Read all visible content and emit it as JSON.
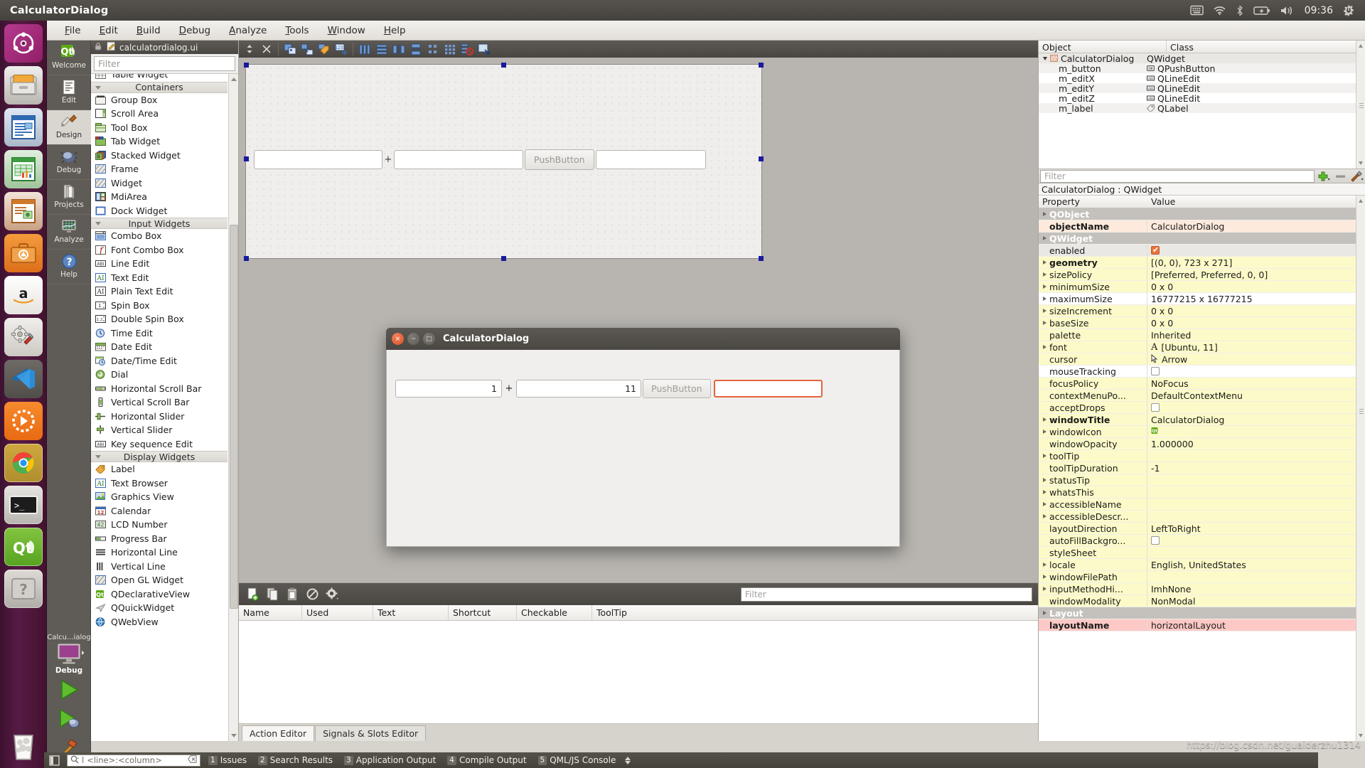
{
  "window": {
    "title": "CalculatorDialog"
  },
  "tray": {
    "icons": [
      "keyboard-icon",
      "wifi-icon",
      "bluetooth-icon",
      "battery-icon",
      "volume-icon"
    ],
    "clock": "09:36",
    "session_icon": "gear-power-icon"
  },
  "launcher": {
    "items": [
      {
        "name": "ubuntu-dash",
        "label": "Ubuntu Dash"
      },
      {
        "name": "files",
        "label": "Files"
      },
      {
        "name": "libreoffice-writer",
        "label": "LibreOffice Writer"
      },
      {
        "name": "libreoffice-calc",
        "label": "LibreOffice Calc"
      },
      {
        "name": "libreoffice-impress",
        "label": "LibreOffice Impress"
      },
      {
        "name": "ubuntu-software",
        "label": "Ubuntu Software"
      },
      {
        "name": "amazon",
        "label": "Amazon"
      },
      {
        "name": "system-settings",
        "label": "System Settings"
      },
      {
        "name": "vs-code",
        "label": "Visual Studio Code"
      },
      {
        "name": "vlc",
        "label": "VLC"
      },
      {
        "name": "google-chrome",
        "label": "Google Chrome"
      },
      {
        "name": "terminal",
        "label": "Terminal"
      },
      {
        "name": "qt-creator",
        "label": "Qt Creator"
      },
      {
        "name": "help",
        "label": "Help"
      }
    ],
    "trash_label": "Trash"
  },
  "menubar": {
    "items": [
      {
        "label": "File",
        "mnemonic": "F"
      },
      {
        "label": "Edit",
        "mnemonic": "E"
      },
      {
        "label": "Build",
        "mnemonic": "B"
      },
      {
        "label": "Debug",
        "mnemonic": "D"
      },
      {
        "label": "Analyze",
        "mnemonic": "A"
      },
      {
        "label": "Tools",
        "mnemonic": "T"
      },
      {
        "label": "Window",
        "mnemonic": "W"
      },
      {
        "label": "Help",
        "mnemonic": "H"
      }
    ]
  },
  "modes": [
    {
      "label": "Welcome",
      "icon": "qt-logo-icon",
      "active": false
    },
    {
      "label": "Edit",
      "icon": "document-icon",
      "active": false
    },
    {
      "label": "Design",
      "icon": "ruler-pencil-icon",
      "active": true
    },
    {
      "label": "Debug",
      "icon": "bug-icon",
      "active": false
    },
    {
      "label": "Projects",
      "icon": "book-icon",
      "active": false
    },
    {
      "label": "Analyze",
      "icon": "monitor-graph-icon",
      "active": false
    },
    {
      "label": "Help",
      "icon": "question-mark-icon",
      "active": false
    }
  ],
  "run_block": {
    "kit_label": "Calcu...ialog",
    "build_config": "Debug",
    "run_label": "Run",
    "debug_label": "Start Debugging",
    "build_label": "Build"
  },
  "widget_box": {
    "dock_title": "calculatordialog.ui",
    "filter_placeholder": "Filter",
    "clipped_top_item": "Table Widget",
    "categories": [
      {
        "name": "Containers",
        "items": [
          {
            "label": "Group Box",
            "icon": "group-box-icon"
          },
          {
            "label": "Scroll Area",
            "icon": "scroll-area-icon"
          },
          {
            "label": "Tool Box",
            "icon": "tool-box-icon"
          },
          {
            "label": "Tab Widget",
            "icon": "tab-widget-icon"
          },
          {
            "label": "Stacked Widget",
            "icon": "stacked-widget-icon"
          },
          {
            "label": "Frame",
            "icon": "frame-icon"
          },
          {
            "label": "Widget",
            "icon": "widget-icon"
          },
          {
            "label": "MdiArea",
            "icon": "mdi-area-icon"
          },
          {
            "label": "Dock Widget",
            "icon": "dock-widget-icon"
          }
        ]
      },
      {
        "name": "Input Widgets",
        "items": [
          {
            "label": "Combo Box",
            "icon": "combo-box-icon"
          },
          {
            "label": "Font Combo Box",
            "icon": "font-combo-box-icon"
          },
          {
            "label": "Line Edit",
            "icon": "line-edit-icon"
          },
          {
            "label": "Text Edit",
            "icon": "text-edit-icon"
          },
          {
            "label": "Plain Text Edit",
            "icon": "plain-text-edit-icon"
          },
          {
            "label": "Spin Box",
            "icon": "spin-box-icon"
          },
          {
            "label": "Double Spin Box",
            "icon": "double-spin-box-icon"
          },
          {
            "label": "Time Edit",
            "icon": "time-edit-icon"
          },
          {
            "label": "Date Edit",
            "icon": "date-edit-icon"
          },
          {
            "label": "Date/Time Edit",
            "icon": "date-time-edit-icon"
          },
          {
            "label": "Dial",
            "icon": "dial-icon"
          },
          {
            "label": "Horizontal Scroll Bar",
            "icon": "horizontal-scroll-bar-icon"
          },
          {
            "label": "Vertical Scroll Bar",
            "icon": "vertical-scroll-bar-icon"
          },
          {
            "label": "Horizontal Slider",
            "icon": "horizontal-slider-icon"
          },
          {
            "label": "Vertical Slider",
            "icon": "vertical-slider-icon"
          },
          {
            "label": "Key sequence Edit",
            "icon": "key-sequence-edit-icon"
          }
        ]
      },
      {
        "name": "Display Widgets",
        "items": [
          {
            "label": "Label",
            "icon": "label-icon"
          },
          {
            "label": "Text Browser",
            "icon": "text-browser-icon"
          },
          {
            "label": "Graphics View",
            "icon": "graphics-view-icon"
          },
          {
            "label": "Calendar",
            "icon": "calendar-icon"
          },
          {
            "label": "LCD Number",
            "icon": "lcd-number-icon"
          },
          {
            "label": "Progress Bar",
            "icon": "progress-bar-icon"
          },
          {
            "label": "Horizontal Line",
            "icon": "horizontal-line-icon"
          },
          {
            "label": "Vertical Line",
            "icon": "vertical-line-icon"
          },
          {
            "label": "Open GL Widget",
            "icon": "open-gl-widget-icon"
          },
          {
            "label": "QDeclarativeView",
            "icon": "qdeclarativeview-icon"
          },
          {
            "label": "QQuickWidget",
            "icon": "qquickwidget-icon"
          },
          {
            "label": "QWebView",
            "icon": "qwebview-icon"
          }
        ]
      }
    ]
  },
  "editor": {
    "document_name": "calculatordialog.ui",
    "toolbar_icons": [
      "split-selector-icon",
      "close-icon",
      "edit-widgets-icon",
      "edit-signals-slots-icon",
      "edit-buddies-icon",
      "edit-tab-order-icon",
      "layout-horizontally-icon",
      "layout-vertically-icon",
      "layout-splitter-h-icon",
      "layout-splitter-v-icon",
      "layout-form-icon",
      "layout-grid-icon",
      "break-layout-icon",
      "adjust-size-icon"
    ]
  },
  "form_preview": {
    "edit_x": "",
    "operator": "+",
    "edit_y": "",
    "button_label": "PushButton",
    "edit_z": ""
  },
  "running_dialog": {
    "title": "CalculatorDialog",
    "edit_x": "1",
    "operator": "+",
    "edit_y": "11",
    "button_label": "PushButton",
    "edit_z": ""
  },
  "object_inspector": {
    "headers": [
      "Object",
      "Class"
    ],
    "rows": [
      {
        "object": "CalculatorDialog",
        "class": "QWidget",
        "icon": "qwidget-icon",
        "depth": 0,
        "expanded": true,
        "selected": true
      },
      {
        "object": "m_button",
        "class": "QPushButton",
        "icon": "qpushbutton-icon",
        "depth": 1,
        "selected": false
      },
      {
        "object": "m_editX",
        "class": "QLineEdit",
        "icon": "qlineedit-icon",
        "depth": 1,
        "selected": false
      },
      {
        "object": "m_editY",
        "class": "QLineEdit",
        "icon": "qlineedit-icon",
        "depth": 1,
        "selected": false
      },
      {
        "object": "m_editZ",
        "class": "QLineEdit",
        "icon": "qlineedit-icon",
        "depth": 1,
        "selected": false
      },
      {
        "object": "m_label",
        "class": "QLabel",
        "icon": "qlabel-icon",
        "depth": 1,
        "selected": false
      }
    ]
  },
  "property_editor": {
    "filter_placeholder": "Filter",
    "add_button": "add-icon",
    "remove_button": "remove-icon",
    "configure_button": "configure-icon",
    "selection": "CalculatorDialog : QWidget",
    "headers": [
      "Property",
      "Value"
    ],
    "rows": [
      {
        "name": "QObject",
        "value": "",
        "style": "group",
        "expander": true
      },
      {
        "name": "objectName",
        "value": "CalculatorDialog",
        "style": "peach",
        "bold": true
      },
      {
        "name": "QWidget",
        "value": "",
        "style": "group",
        "expander": true
      },
      {
        "name": "enabled",
        "value": "",
        "style": "gray",
        "checkbox": "on",
        "revert": true
      },
      {
        "name": "geometry",
        "value": "[(0, 0), 723 x 271]",
        "style": "yellow",
        "expander": true,
        "bold": true
      },
      {
        "name": "sizePolicy",
        "value": "[Preferred, Preferred, 0, 0]",
        "style": "yellow",
        "expander": true
      },
      {
        "name": "minimumSize",
        "value": "0 x 0",
        "style": "yellow",
        "expander": true
      },
      {
        "name": "maximumSize",
        "value": "16777215 x 16777215",
        "style": "white",
        "expander": true
      },
      {
        "name": "sizeIncrement",
        "value": "0 x 0",
        "style": "yellow",
        "expander": true
      },
      {
        "name": "baseSize",
        "value": "0 x 0",
        "style": "yellow",
        "expander": true
      },
      {
        "name": "palette",
        "value": "Inherited",
        "style": "yellow"
      },
      {
        "name": "font",
        "value": "[Ubuntu, 11]",
        "style": "yellow",
        "expander": true,
        "glyph": "A"
      },
      {
        "name": "cursor",
        "value": "Arrow",
        "style": "yellow",
        "glyph": "cursor-arrow-icon"
      },
      {
        "name": "mouseTracking",
        "value": "",
        "style": "white",
        "checkbox": "off"
      },
      {
        "name": "focusPolicy",
        "value": "NoFocus",
        "style": "yellow"
      },
      {
        "name": "contextMenuPo...",
        "value": "DefaultContextMenu",
        "style": "yellow"
      },
      {
        "name": "acceptDrops",
        "value": "",
        "style": "yellow",
        "checkbox": "off"
      },
      {
        "name": "windowTitle",
        "value": "CalculatorDialog",
        "style": "yellow",
        "expander": true,
        "bold": true
      },
      {
        "name": "windowIcon",
        "value": "",
        "style": "yellow",
        "expander": true,
        "glyph": "qt-icon"
      },
      {
        "name": "windowOpacity",
        "value": "1.000000",
        "style": "yellow"
      },
      {
        "name": "toolTip",
        "value": "",
        "style": "yellow",
        "expander": true
      },
      {
        "name": "toolTipDuration",
        "value": "-1",
        "style": "yellow"
      },
      {
        "name": "statusTip",
        "value": "",
        "style": "yellow",
        "expander": true
      },
      {
        "name": "whatsThis",
        "value": "",
        "style": "yellow",
        "expander": true
      },
      {
        "name": "accessibleName",
        "value": "",
        "style": "yellow",
        "expander": true
      },
      {
        "name": "accessibleDescr...",
        "value": "",
        "style": "yellow",
        "expander": true
      },
      {
        "name": "layoutDirection",
        "value": "LeftToRight",
        "style": "yellow"
      },
      {
        "name": "autoFillBackgro...",
        "value": "",
        "style": "yellow",
        "checkbox": "off"
      },
      {
        "name": "styleSheet",
        "value": "",
        "style": "yellow"
      },
      {
        "name": "locale",
        "value": "English, UnitedStates",
        "style": "yellow",
        "expander": true
      },
      {
        "name": "windowFilePath",
        "value": "",
        "style": "yellow",
        "expander": true
      },
      {
        "name": "inputMethodHi...",
        "value": "ImhNone",
        "style": "yellow",
        "expander": true
      },
      {
        "name": "windowModality",
        "value": "NonModal",
        "style": "yellow"
      },
      {
        "name": "Layout",
        "value": "",
        "style": "group",
        "expander": true
      },
      {
        "name": "layoutName",
        "value": "horizontalLayout",
        "style": "pink",
        "bold": true
      }
    ]
  },
  "action_editor": {
    "toolbar_icons": [
      "new-action-icon",
      "copy-icon",
      "paste-icon",
      "delete-icon",
      "settings-icon"
    ],
    "filter_placeholder": "Filter",
    "headers": [
      "Name",
      "Used",
      "Text",
      "Shortcut",
      "Checkable",
      "ToolTip"
    ],
    "rows": [],
    "tabs": [
      {
        "label": "Action Editor",
        "active": true
      },
      {
        "label": "Signals & Slots Editor",
        "active": false
      }
    ]
  },
  "status_bar": {
    "line_column_placeholder": "<line>:<column>",
    "line_column_prefix": "l",
    "outputs": [
      {
        "num": "1",
        "label": "Issues",
        "active": false
      },
      {
        "num": "2",
        "label": "Search Results",
        "active": false
      },
      {
        "num": "3",
        "label": "Application Output",
        "active": false
      },
      {
        "num": "4",
        "label": "Compile Output",
        "active": false
      },
      {
        "num": "5",
        "label": "QML/JS Console",
        "active": false
      }
    ]
  },
  "watermark": "https://blog.csdn.net/guaiderzhu1314"
}
